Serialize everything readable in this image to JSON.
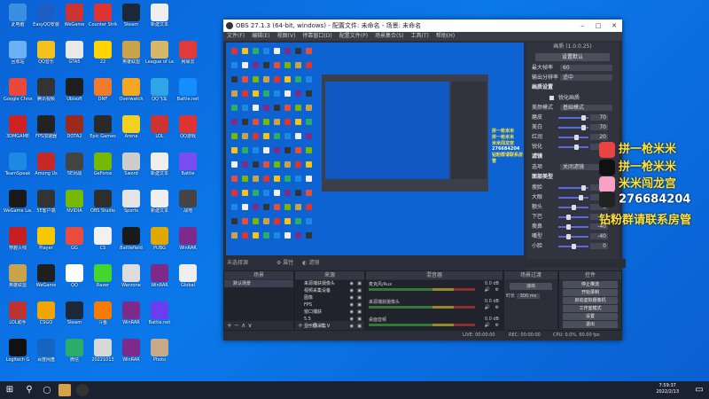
{
  "desktop": {
    "icons": [
      {
        "label": "此电脑",
        "color": "#3b8fe0"
      },
      {
        "label": "EasyQQ安装",
        "color": "#1c5ec4"
      },
      {
        "label": "WeGame",
        "color": "#c33"
      },
      {
        "label": "Counter Strike",
        "color": "#d33"
      },
      {
        "label": "Steam",
        "color": "#1b2838"
      },
      {
        "label": "新建文本",
        "color": "#eee"
      },
      {
        "label": "回收站",
        "color": "#6ab0f3"
      },
      {
        "label": "QQ音乐",
        "color": "#f4c21b"
      },
      {
        "label": "GTA5",
        "color": "#e9e9e9"
      },
      {
        "label": "22",
        "color": "#ffd400"
      },
      {
        "label": "英雄联盟",
        "color": "#c9a34a"
      },
      {
        "label": "League of Legends",
        "color": "#d7b86a"
      },
      {
        "label": "网易云",
        "color": "#e03a3a"
      },
      {
        "label": "Google Chrome",
        "color": "#e9493c"
      },
      {
        "label": "腾讯视频",
        "color": "#333"
      },
      {
        "label": "Ubisoft",
        "color": "#1f1f1f"
      },
      {
        "label": "DNF",
        "color": "#f07b2a"
      },
      {
        "label": "Overwatch",
        "color": "#f5a623"
      },
      {
        "label": "QQ飞车",
        "color": "#2fa4e7"
      },
      {
        "label": "Battle.net",
        "color": "#148eff"
      },
      {
        "label": "3DMGAME",
        "color": "#c22"
      },
      {
        "label": "FPS加速器",
        "color": "#222"
      },
      {
        "label": "DOTA2",
        "color": "#9c2a1c"
      },
      {
        "label": "Epic Games",
        "color": "#2a2a2a"
      },
      {
        "label": "Arena",
        "color": "#f2d11f"
      },
      {
        "label": "LOL",
        "color": "#c33"
      },
      {
        "label": "QQ游戏",
        "color": "#d33"
      },
      {
        "label": "TeamSpeak",
        "color": "#1e88e5"
      },
      {
        "label": "Among Us",
        "color": "#c62828"
      },
      {
        "label": "5E对战",
        "color": "#444"
      },
      {
        "label": "GeForce",
        "color": "#76b900"
      },
      {
        "label": "Sword",
        "color": "#ccc"
      },
      {
        "label": "新建文本",
        "color": "#eee"
      },
      {
        "label": "Battle",
        "color": "#7a4df2"
      },
      {
        "label": "WeGame Launcher",
        "color": "#1a1a1a"
      },
      {
        "label": "5E客户端",
        "color": "#333"
      },
      {
        "label": "NVIDIA",
        "color": "#76b900"
      },
      {
        "label": "OBS Studio",
        "color": "#2e2e2e"
      },
      {
        "label": "Sports",
        "color": "#e5e5e5"
      },
      {
        "label": "新建文本",
        "color": "#eee"
      },
      {
        "label": "战地",
        "color": "#444"
      },
      {
        "label": "穿越火线",
        "color": "#c71f1f"
      },
      {
        "label": "Player",
        "color": "#f5c800"
      },
      {
        "label": "GG",
        "color": "#e74c3c"
      },
      {
        "label": "CS",
        "color": "#f1f1f1"
      },
      {
        "label": "Battlefield",
        "color": "#1a1a1a"
      },
      {
        "label": "PUBG",
        "color": "#e0a800"
      },
      {
        "label": "WinRAR",
        "color": "#7e2a8a"
      },
      {
        "label": "英雄联盟",
        "color": "#c9a34a"
      },
      {
        "label": "WeGame",
        "color": "#1f1f1f"
      },
      {
        "label": "QQ",
        "color": "#fff"
      },
      {
        "label": "Razer",
        "color": "#44d62c"
      },
      {
        "label": "Warzone",
        "color": "#ddd"
      },
      {
        "label": "WinRAR",
        "color": "#7e2a8a"
      },
      {
        "label": "Global",
        "color": "#eee"
      },
      {
        "label": "LOL助手",
        "color": "#b33"
      },
      {
        "label": "CSGO",
        "color": "#f0a500"
      },
      {
        "label": "Steam",
        "color": "#1b2838"
      },
      {
        "label": "斗鱼",
        "color": "#f57c00"
      },
      {
        "label": "WinRAR",
        "color": "#7e2a8a"
      },
      {
        "label": "Battle.net",
        "color": "#6a3df0"
      },
      {
        "label": "Logitech G",
        "color": "#111"
      },
      {
        "label": "百度网盘",
        "color": "#1565c0"
      },
      {
        "label": "微信",
        "color": "#2aae67"
      },
      {
        "label": "20221013",
        "color": "#d8d8d8"
      },
      {
        "label": "WinRAR",
        "color": "#7e2a8a"
      },
      {
        "label": "Photo",
        "color": "#c8a98a"
      }
    ]
  },
  "obs": {
    "title": "OBS 27.1.3 (64-bit, windows) - 配置文件: 未命名 - 场景: 未命名",
    "menu": [
      "文件(F)",
      "编辑(E)",
      "视图(V)",
      "停靠窗口(D)",
      "配置文件(P)",
      "场景集合(S)",
      "工具(T)",
      "帮助(H)"
    ],
    "not_live_label": "未选择源",
    "properties_label": "属性",
    "filters_label": "滤镜",
    "right_panel": {
      "title": "画质 (1.0.0.25)",
      "button": "设置默认",
      "rows": [
        {
          "label": "最大帧率",
          "value": "60"
        },
        {
          "label": "输出分辨率",
          "value": "适中"
        }
      ],
      "section1": "画质设置",
      "checkbox_label": "锐化画质",
      "mode_label": "美颜模式",
      "mode_value": "基础模式",
      "sliders1": [
        {
          "label": "磨皮",
          "value": "70"
        },
        {
          "label": "美白",
          "value": "70"
        },
        {
          "label": "红润",
          "value": "20"
        },
        {
          "label": "锐化",
          "value": "20"
        }
      ],
      "section2": "滤镜",
      "filter_label": "选项",
      "filter_value": "关闭滤镜",
      "section3": "面部美型",
      "sliders2": [
        {
          "label": "瘦脸",
          "value": "70"
        },
        {
          "label": "大眼",
          "value": "50"
        },
        {
          "label": "额头",
          "value": "0"
        },
        {
          "label": "下巴",
          "value": "-40"
        },
        {
          "label": "瘦鼻",
          "value": "-40"
        },
        {
          "label": "嘴型",
          "value": "-40"
        },
        {
          "label": "小脸",
          "value": "0"
        }
      ]
    },
    "docks": {
      "scenes": {
        "header": "场景",
        "items": [
          "默认场景"
        ]
      },
      "sources": {
        "header": "来源",
        "items": [
          "来源捕获摄像头",
          "视频采集设备",
          "图像",
          "FPS",
          "窗口捕获",
          "5.5",
          "显示器采集"
        ]
      },
      "mixer": {
        "header": "混音器",
        "channels": [
          {
            "name": "麦克风/Aux",
            "db": "0.0 dB"
          },
          {
            "name": "来源捕获摄像头",
            "db": "0.0 dB"
          },
          {
            "name": "桌面音频",
            "db": "0.0 dB"
          }
        ]
      },
      "transitions": {
        "header": "场景过渡",
        "type": "淡出",
        "duration_label": "时长",
        "duration": "300 ms"
      },
      "controls": {
        "header": "控件",
        "buttons": [
          "停止推流",
          "开始录制",
          "启动虚拟摄像机",
          "工作室模式",
          "设置",
          "退出"
        ]
      }
    },
    "status": {
      "live": "LIVE: 00:00:00",
      "rec": "REC: 00:00:00",
      "cpu": "CPU: 0.0%, 60.00 fps"
    }
  },
  "overlay": {
    "lines": [
      {
        "text": "拼一枪米米",
        "icon": "weibo-icon",
        "color": "#e94343"
      },
      {
        "text": "拼一枪米米",
        "icon": "tiktok-icon",
        "color": "#111"
      },
      {
        "text": "米米闯龙宫",
        "icon": "bilibili-icon",
        "color": "#f7a1c4"
      },
      {
        "text": "276684204",
        "icon": "qq-icon",
        "color": "#222"
      },
      {
        "text": "钻粉群请联系房管",
        "icon": "",
        "color": ""
      }
    ]
  },
  "taskbar": {
    "time": "7:59:37",
    "date": "2022/2/13"
  }
}
